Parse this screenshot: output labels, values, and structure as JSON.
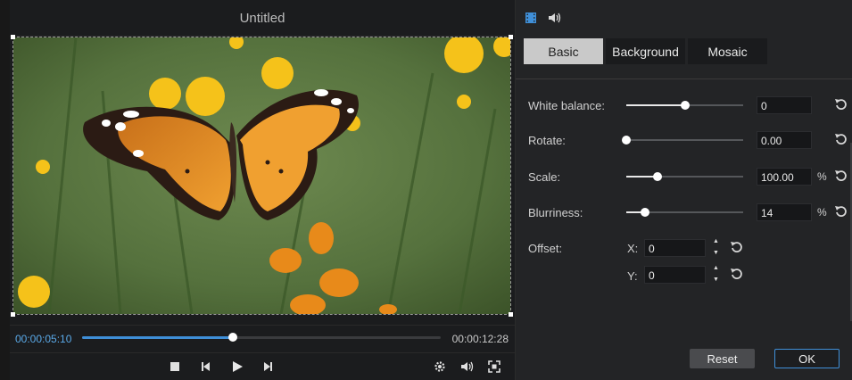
{
  "player": {
    "title": "Untitled",
    "current_time": "00:00:05:10",
    "total_time": "00:00:12:28",
    "progress_fraction": 0.42
  },
  "panel": {
    "icons": [
      "film-icon",
      "speaker-icon"
    ],
    "tabs": [
      {
        "label": "Basic",
        "active": true
      },
      {
        "label": "Background",
        "active": false
      },
      {
        "label": "Mosaic",
        "active": false
      }
    ],
    "settings": {
      "white_balance": {
        "label": "White balance:",
        "value": "0",
        "level": 0.5
      },
      "rotate": {
        "label": "Rotate:",
        "value": "0.00",
        "level": 0.0
      },
      "scale": {
        "label": "Scale:",
        "value": "100.00",
        "unit": "%",
        "level": 0.27
      },
      "blurriness": {
        "label": "Blurriness:",
        "value": "14",
        "unit": "%",
        "level": 0.16
      },
      "offset": {
        "label": "Offset:",
        "x_label": "X:",
        "x_value": "0",
        "y_label": "Y:",
        "y_value": "0"
      }
    },
    "reset_label": "Reset",
    "ok_label": "OK"
  },
  "colors": {
    "accent": "#3f8fd8",
    "panel_bg": "#232426",
    "tab_active": "#c9c9c9"
  }
}
